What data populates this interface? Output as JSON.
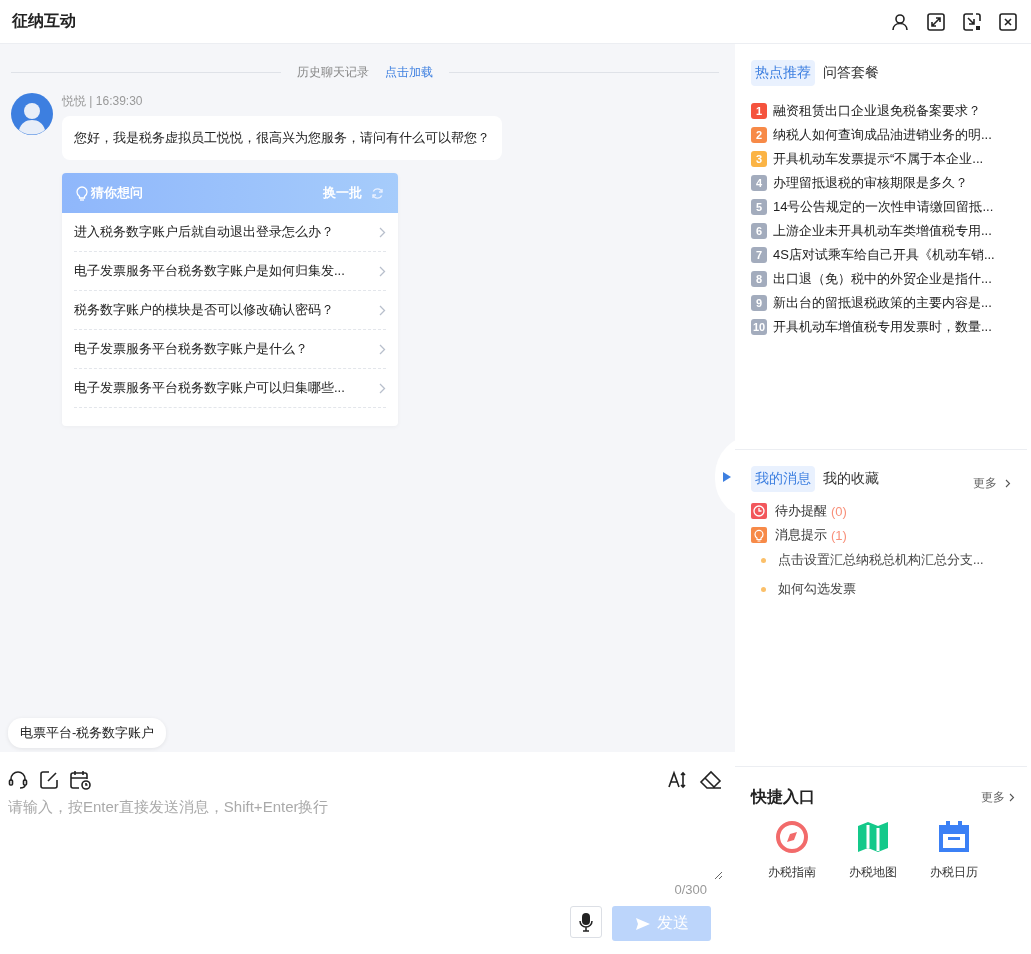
{
  "window": {
    "title": "征纳互动"
  },
  "history": {
    "label": "历史聊天记录",
    "link": "点击加载"
  },
  "message": {
    "sender": "悦悦 | 16:39:30",
    "text": "您好，我是税务虚拟员工悦悦，很高兴为您服务，请问有什么可以帮您？"
  },
  "suggestions": {
    "title": "猜你想问",
    "refresh": "换一批",
    "items": [
      "进入税务数字账户后就自动退出登录怎么办？",
      "电子发票服务平台税务数字账户是如何归集发...",
      "税务数字账户的模块是否可以修改确认密码？",
      "电子发票服务平台税务数字账户是什么？",
      "电子发票服务平台税务数字账户可以归集哪些..."
    ]
  },
  "topic_chip": "电票平台-税务数字账户",
  "composer": {
    "placeholder": "请输入，按Enter直接发送消息，Shift+Enter换行",
    "counter": "0/300",
    "send": "发送",
    "send_disabled": true
  },
  "hot_tabs": [
    {
      "label": "热点推荐",
      "selected": true
    },
    {
      "label": "问答套餐",
      "selected": false
    }
  ],
  "hot_list": [
    {
      "rank": "1",
      "text": "融资租赁出口企业退免税备案要求？",
      "color": "#f5533d"
    },
    {
      "rank": "2",
      "text": "纳税人如何查询成品油进销业务的明...",
      "color": "#f78a48"
    },
    {
      "rank": "3",
      "text": "开具机动车发票提示“不属于本企业...",
      "color": "#fbb445"
    },
    {
      "rank": "4",
      "text": "办理留抵退税的审核期限是多久？",
      "color": "#a3acbd"
    },
    {
      "rank": "5",
      "text": "14号公告规定的一次性申请缴回留抵...",
      "color": "#a3acbd"
    },
    {
      "rank": "6",
      "text": "上游企业未开具机动车类增值税专用...",
      "color": "#a3acbd"
    },
    {
      "rank": "7",
      "text": "4S店对试乘车给自己开具《机动车销...",
      "color": "#a3acbd"
    },
    {
      "rank": "8",
      "text": "出口退（免）税中的外贸企业是指什...",
      "color": "#a3acbd"
    },
    {
      "rank": "9",
      "text": "新出台的留抵退税政策的主要内容是...",
      "color": "#a3acbd"
    },
    {
      "rank": "10",
      "text": "开具机动车增值税专用发票时，数量...",
      "color": "#a3acbd"
    }
  ],
  "message_tabs": [
    {
      "label": "我的消息",
      "selected": true
    },
    {
      "label": "我的收藏",
      "selected": false
    }
  ],
  "message_more": "更多",
  "message_groups": [
    {
      "kind": "todo",
      "label": "待办提醒",
      "count": "(0)"
    },
    {
      "kind": "notice",
      "label": "消息提示",
      "count": "(1)"
    }
  ],
  "notices": [
    "点击设置汇总纳税总机构汇总分支...",
    "如何勾选发票"
  ],
  "quick": {
    "title": "快捷入口",
    "more": "更多",
    "items": [
      {
        "kind": "guide",
        "label": "办税指南"
      },
      {
        "kind": "map",
        "label": "办税地图"
      },
      {
        "kind": "calendar",
        "label": "办税日历"
      }
    ]
  }
}
